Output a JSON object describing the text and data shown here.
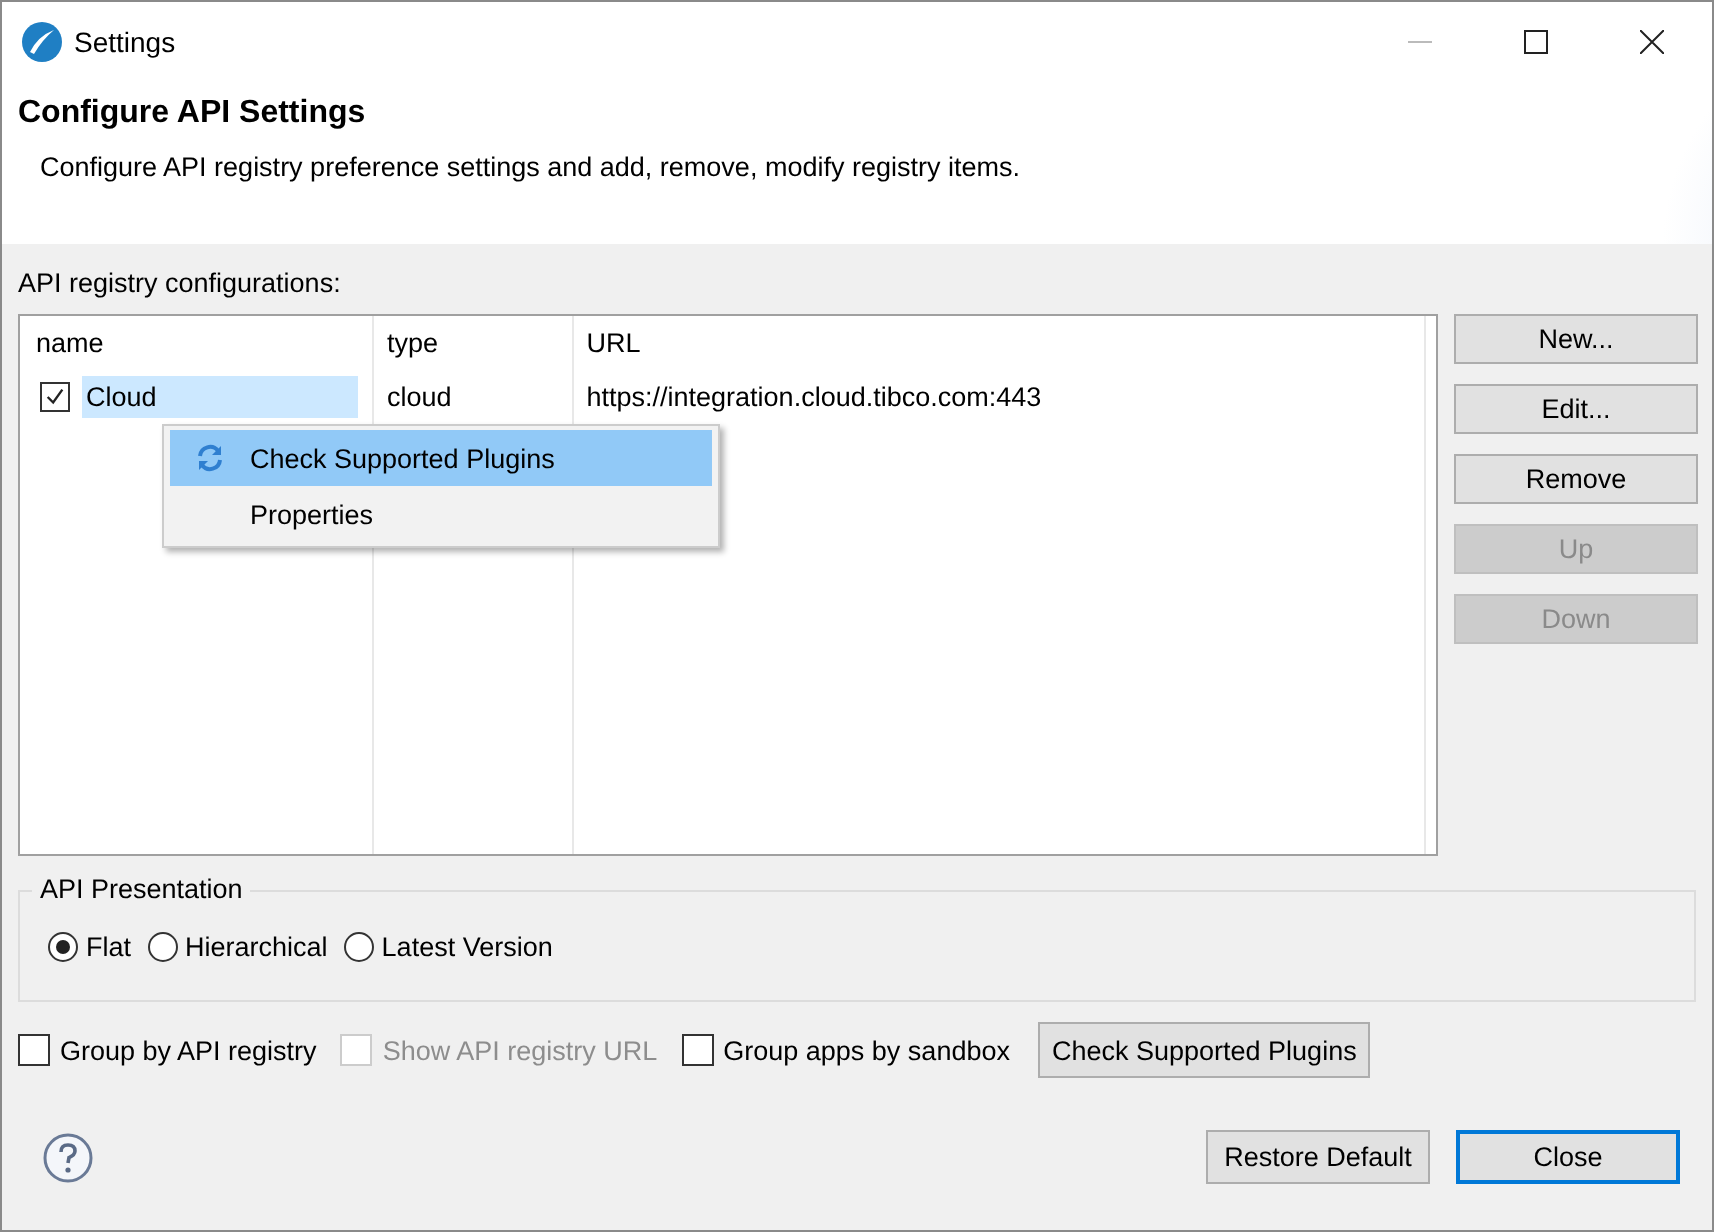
{
  "window": {
    "title": "Settings"
  },
  "header": {
    "title": "Configure API Settings",
    "description": "Configure API registry preference settings and add, remove, modify registry items."
  },
  "registry": {
    "label": "API registry configurations:",
    "columns": [
      "name",
      "type",
      "URL"
    ],
    "rows": [
      {
        "checked": true,
        "selected": true,
        "cells": [
          "Cloud",
          "cloud",
          "https://integration.cloud.tibco.com:443"
        ]
      }
    ],
    "buttons": [
      {
        "label": "New...",
        "disabled": false
      },
      {
        "label": "Edit...",
        "disabled": false
      },
      {
        "label": "Remove",
        "disabled": false
      },
      {
        "label": "Up",
        "disabled": true
      },
      {
        "label": "Down",
        "disabled": true
      }
    ]
  },
  "context_menu": {
    "items": [
      {
        "label": "Check Supported Plugins",
        "kind": "refresh",
        "selected": true
      },
      {
        "label": "Properties",
        "kind": "plain",
        "selected": false
      }
    ]
  },
  "presentation": {
    "title": "API Presentation",
    "options": [
      {
        "label": "Flat",
        "selected": true
      },
      {
        "label": "Hierarchical",
        "selected": false
      },
      {
        "label": "Latest Version",
        "selected": false
      }
    ]
  },
  "options": [
    {
      "label": "Group by API registry",
      "checked": false,
      "disabled": false
    },
    {
      "label": "Show API registry URL",
      "checked": false,
      "disabled": true
    },
    {
      "label": "Group apps by sandbox",
      "checked": false,
      "disabled": false
    }
  ],
  "check_button": "Check Supported Plugins",
  "footer_buttons": [
    {
      "label": "Restore Default",
      "default": false
    },
    {
      "label": "Close",
      "default": true
    }
  ]
}
